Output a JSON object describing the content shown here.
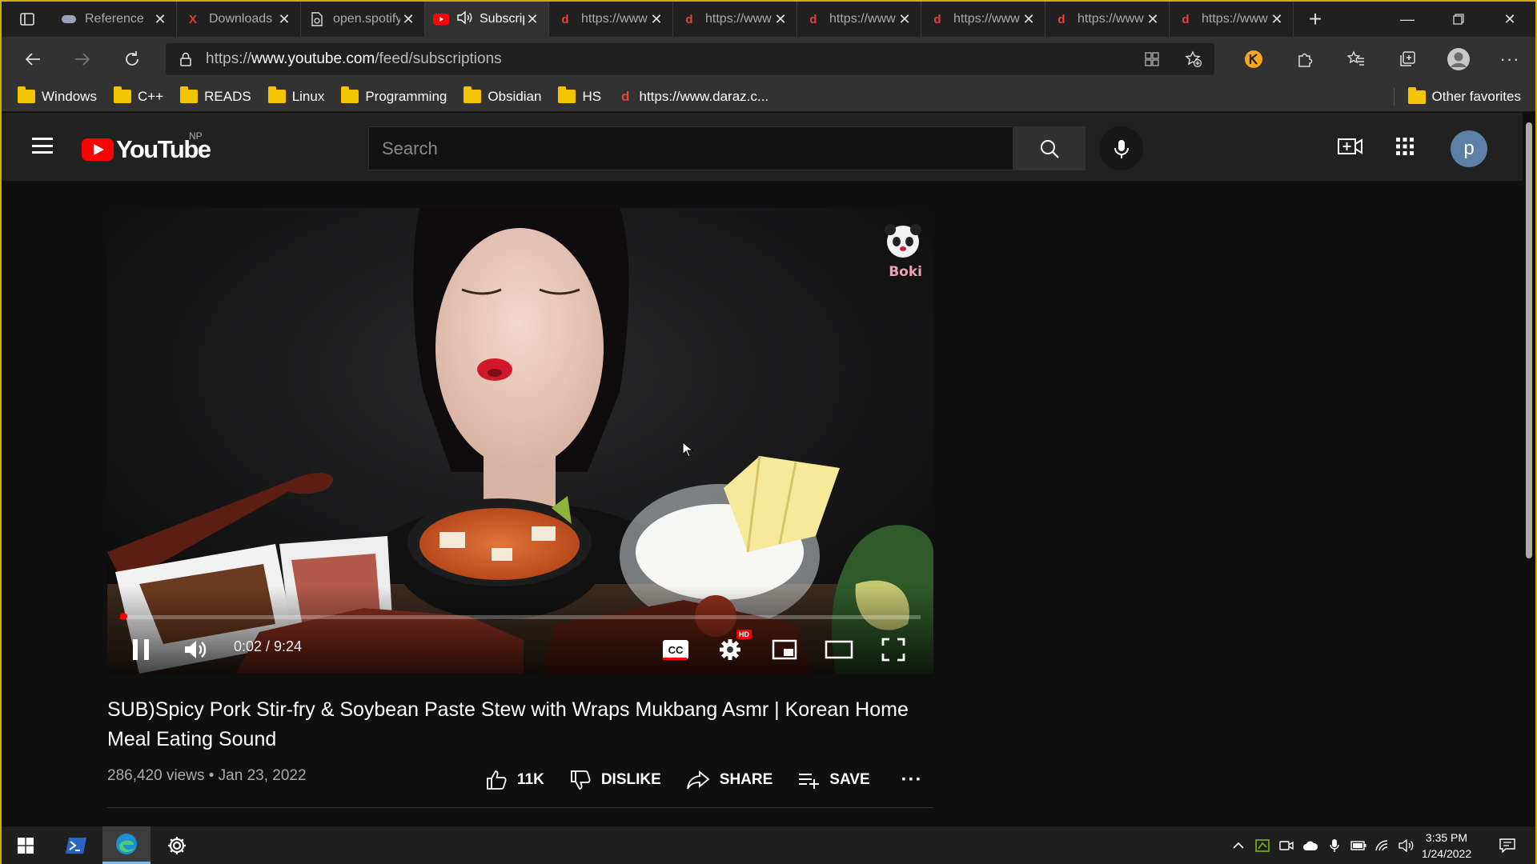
{
  "browser": {
    "tabs": [
      {
        "title": "Reference",
        "favicon": "gamepad-favicon",
        "fav_color": "#9aa0b8",
        "active": false
      },
      {
        "title": "Downloads",
        "favicon": "x-favicon",
        "fav_color": "#e03c2b",
        "active": false
      },
      {
        "title": "open.spotify",
        "favicon": "doc-favicon",
        "fav_color": "#dddddd",
        "active": false
      },
      {
        "title": "Subscriptions",
        "favicon": "youtube-favicon",
        "fav_color": "#ff0000",
        "active": true,
        "audio": true
      },
      {
        "title": "https://www",
        "favicon": "d-favicon",
        "fav_color": "#e8413a",
        "active": false
      },
      {
        "title": "https://www",
        "favicon": "d-favicon",
        "fav_color": "#e8413a",
        "active": false
      },
      {
        "title": "https://www",
        "favicon": "d-favicon",
        "fav_color": "#e8413a",
        "active": false
      },
      {
        "title": "https://www",
        "favicon": "d-favicon",
        "fav_color": "#e8413a",
        "active": false
      },
      {
        "title": "https://www",
        "favicon": "d-favicon",
        "fav_color": "#e8413a",
        "active": false
      },
      {
        "title": "https://www",
        "favicon": "d-favicon",
        "fav_color": "#e8413a",
        "active": false
      }
    ],
    "url_prefix": "https://",
    "url_host": "www.youtube.com",
    "url_path": "/feed/subscriptions",
    "favorites": [
      {
        "label": "Windows",
        "type": "folder"
      },
      {
        "label": "C++",
        "type": "folder"
      },
      {
        "label": "READS",
        "type": "folder"
      },
      {
        "label": "Linux",
        "type": "folder"
      },
      {
        "label": "Programming",
        "type": "folder"
      },
      {
        "label": "Obsidian",
        "type": "folder"
      },
      {
        "label": "HS",
        "type": "folder"
      },
      {
        "label": "https://www.daraz.c...",
        "type": "link"
      }
    ],
    "other_favorites": "Other favorites"
  },
  "youtube": {
    "logo_text": "YouTube",
    "region": "NP",
    "search_placeholder": "Search",
    "avatar_letter": "p",
    "avatar_color": "#5c7fa7"
  },
  "player": {
    "current_time": "0:02",
    "duration": "9:24",
    "time_display": "0:02 / 9:24",
    "progress_fraction": 0.0035,
    "hd_badge": "HD",
    "cc_label": "CC",
    "watermark_text": "Boki"
  },
  "video": {
    "title": "SUB)Spicy Pork Stir-fry & Soybean Paste Stew with Wraps Mukbang Asmr | Korean Home Meal Eating Sound",
    "views": "286,420 views",
    "separator": "•",
    "date": "Jan 23, 2022",
    "meta": "286,420 views • Jan 23, 2022",
    "likes": "11K",
    "dislike_label": "DISLIKE",
    "share_label": "SHARE",
    "save_label": "SAVE"
  },
  "taskbar": {
    "time": "3:35 PM",
    "date": "1/24/2022"
  }
}
